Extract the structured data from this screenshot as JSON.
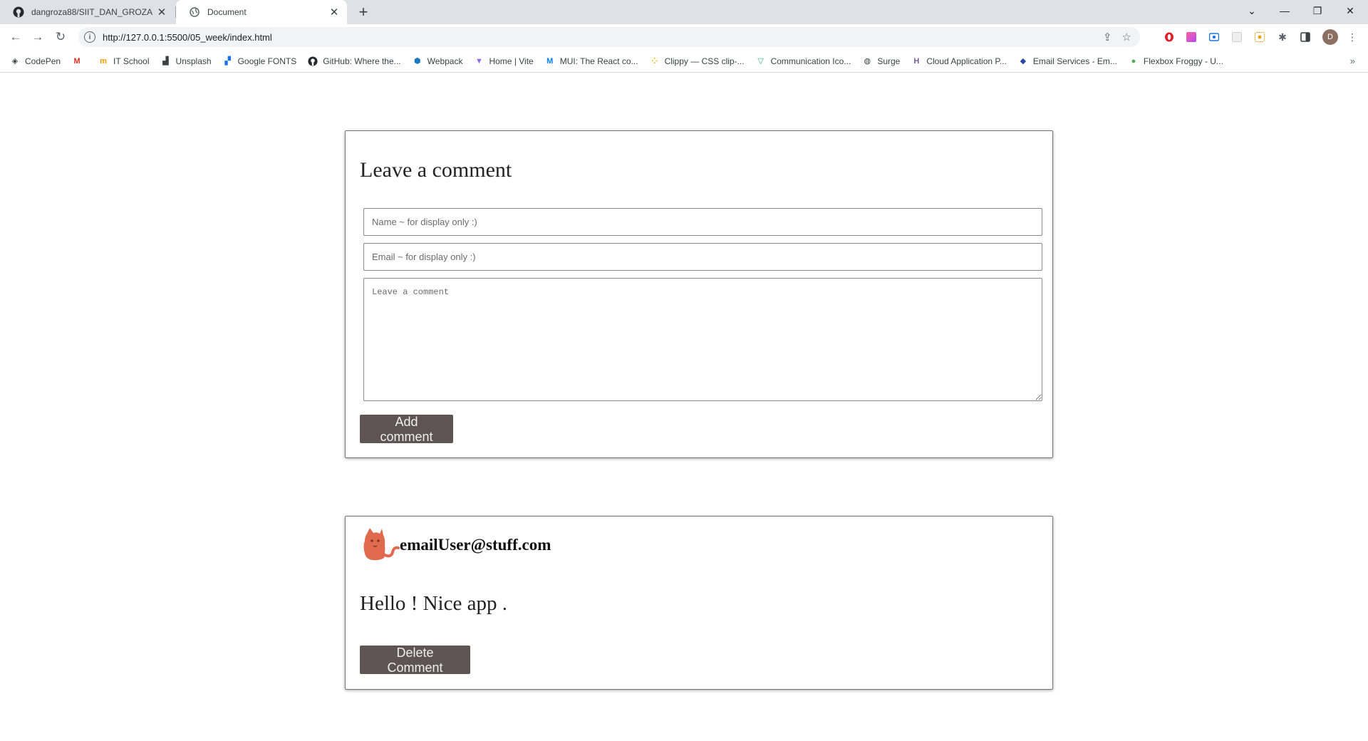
{
  "browser": {
    "tabs": [
      {
        "title": "dangroza88/SIIT_DAN_GROZA",
        "icon": "github-icon",
        "active": false
      },
      {
        "title": "Document",
        "icon": "globe-icon",
        "active": true
      }
    ],
    "url": "http://127.0.0.1:5500/05_week/index.html",
    "profile_initial": "D",
    "bookmarks": [
      {
        "label": "CodePen",
        "icon": "codepen-icon"
      },
      {
        "label": "",
        "icon": "gmail-icon"
      },
      {
        "label": "IT School",
        "icon": "itschool-icon"
      },
      {
        "label": "Unsplash",
        "icon": "unsplash-icon"
      },
      {
        "label": "Google FONTS",
        "icon": "google-fonts-icon"
      },
      {
        "label": "GitHub: Where the...",
        "icon": "github-icon"
      },
      {
        "label": "Webpack",
        "icon": "webpack-icon"
      },
      {
        "label": "Home | Vite",
        "icon": "vite-icon"
      },
      {
        "label": "MUI: The React co...",
        "icon": "mui-icon"
      },
      {
        "label": "Clippy — CSS clip-...",
        "icon": "clippy-icon"
      },
      {
        "label": "Communication Ico...",
        "icon": "vue-icon"
      },
      {
        "label": "Surge",
        "icon": "globe-icon"
      },
      {
        "label": "Cloud Application P...",
        "icon": "heroku-icon"
      },
      {
        "label": "Email Services - Em...",
        "icon": "emailjs-icon"
      },
      {
        "label": "Flexbox Froggy - U...",
        "icon": "frog-icon"
      }
    ],
    "colors": {
      "tabbar": "#dee1e6",
      "omnibox": "#f1f3f4"
    }
  },
  "form": {
    "title": "Leave a comment",
    "name_placeholder": "Name ~ for display only :)",
    "email_placeholder": "Email ~ for display only :)",
    "comment_placeholder": "Leave a comment",
    "submit_label": "Add comment"
  },
  "comments": [
    {
      "email": "emailUser@stuff.com",
      "text": "Hello ! Nice app .",
      "delete_label": "Delete Comment",
      "avatar_icon": "cat-avatar-icon"
    }
  ],
  "theme": {
    "button_bg": "#5e5454",
    "avatar_color": "#e06a4e"
  }
}
